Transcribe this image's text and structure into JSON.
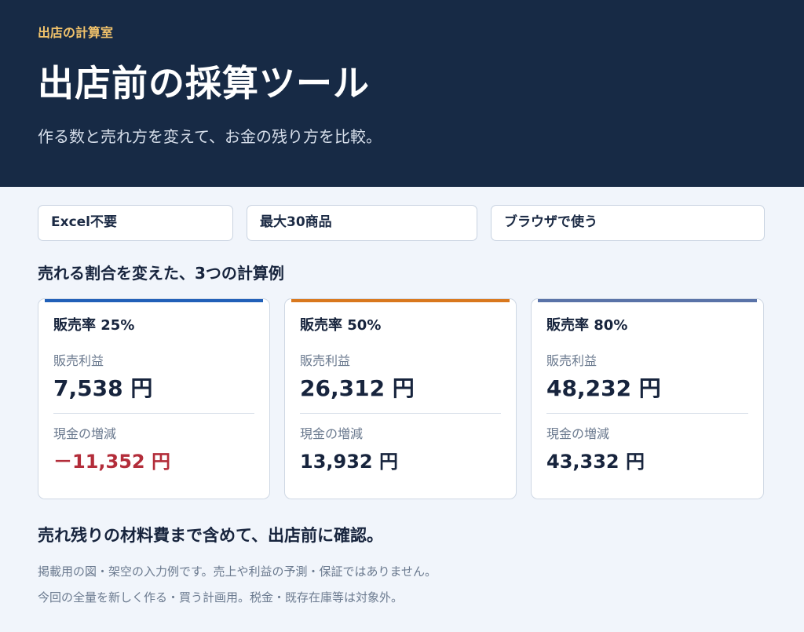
{
  "header": {
    "eyebrow": "出店の計算室",
    "title": "出店前の採算ツール",
    "subtitle": "作る数と売れ方を変えて、お金の残り方を比較。"
  },
  "tags": [
    "Excel不要",
    "最大30商品",
    "ブラウザで使う"
  ],
  "examples_heading": "売れる割合を変えた、3つの計算例",
  "labels": {
    "profit": "販売利益",
    "cash": "現金の増減"
  },
  "cards": [
    {
      "name": "販売率 25%",
      "profit": "7,538 円",
      "cash": "－11,352 円",
      "accent": "#2160b8",
      "cash_negative": true
    },
    {
      "name": "販売率 50%",
      "profit": "26,312 円",
      "cash": "13,932 円",
      "accent": "#d9781e",
      "cash_negative": false
    },
    {
      "name": "販売率 80%",
      "profit": "48,232 円",
      "cash": "43,332 円",
      "accent": "#5a73a8",
      "cash_negative": false
    }
  ],
  "closing_heading": "売れ残りの材料費まで含めて、出店前に確認。",
  "notes": [
    "掲載用の図・架空の入力例です。売上や利益の予測・保証ではありません。",
    "今回の全量を新しく作る・買う計画用。税金・既存在庫等は対象外。"
  ]
}
